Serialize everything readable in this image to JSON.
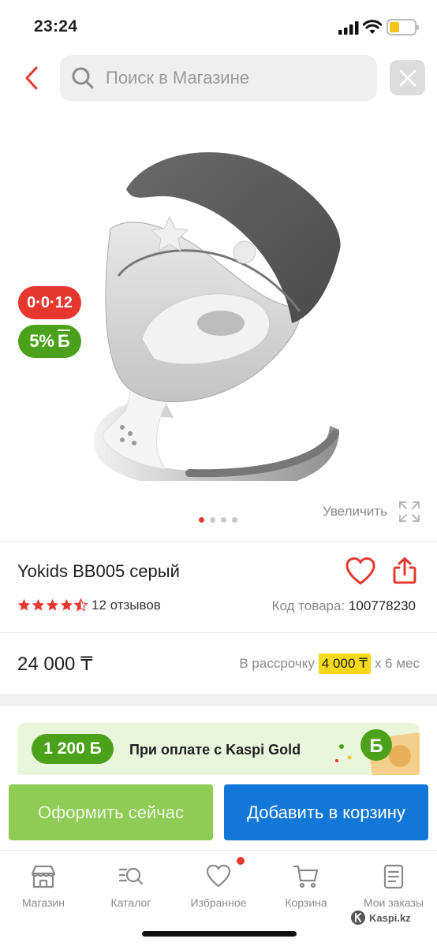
{
  "status_bar": {
    "time": "23:24"
  },
  "search": {
    "placeholder": "Поиск в Магазине"
  },
  "gallery": {
    "credit_badge": "0·0·12",
    "bonus_badge": "5%",
    "bonus_symbol": "Б",
    "zoom_label": "Увеличить",
    "image_count": 4,
    "active_image": 1
  },
  "product": {
    "title": "Yokids BB005 серый",
    "rating": 4.5,
    "reviews": "12 отзывов",
    "sku_label": "Код товара:",
    "sku_value": "100778230",
    "price": "24 000 ₸",
    "installment_prefix": "В рассрочку",
    "installment_amount": "4 000 ₸",
    "installment_suffix": "х 6 мес"
  },
  "kaspi_gold": {
    "bonus": "1 200 Б",
    "text": "При оплате с Kaspi Gold"
  },
  "actions": {
    "buy_now": "Оформить сейчас",
    "add_to_cart": "Добавить в корзину"
  },
  "nav": {
    "items": [
      {
        "label": "Магазин",
        "icon": "store-icon"
      },
      {
        "label": "Каталог",
        "icon": "catalog-icon"
      },
      {
        "label": "Избранное",
        "icon": "heart-icon"
      },
      {
        "label": "Корзина",
        "icon": "cart-icon"
      },
      {
        "label": "Мои заказы",
        "icon": "orders-icon"
      }
    ]
  },
  "watermark": "Kaspi.kz",
  "colors": {
    "accent_red": "#e8372f",
    "bonus_green": "#4ba21a",
    "buy_green": "#8fcc55",
    "cart_blue": "#1177d8",
    "installment_yellow": "#f6d917"
  }
}
